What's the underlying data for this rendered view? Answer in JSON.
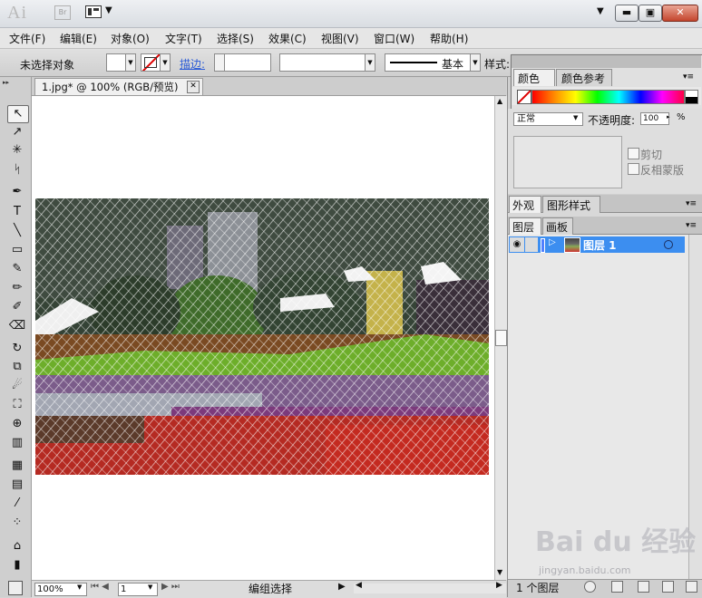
{
  "titlebar": {
    "app_logo": "Ai",
    "bridge_label": "Br",
    "icons": [
      "arrange-documents-icon",
      "chevron-down-icon",
      "minimize-icon",
      "maximize-icon",
      "close-icon"
    ],
    "minimize_glyph": "▬",
    "maximize_glyph": "▣",
    "close_glyph": "✕",
    "dropdown_glyph": "▼"
  },
  "menubar": {
    "items": [
      {
        "label": "文件(F)"
      },
      {
        "label": "编辑(E)"
      },
      {
        "label": "对象(O)"
      },
      {
        "label": "文字(T)"
      },
      {
        "label": "选择(S)"
      },
      {
        "label": "效果(C)"
      },
      {
        "label": "视图(V)"
      },
      {
        "label": "窗口(W)"
      },
      {
        "label": "帮助(H)"
      }
    ]
  },
  "controlbar": {
    "selection_status": "未选择对象",
    "stroke_label": "描边:",
    "stroke_profile": "基本",
    "style_label": "样式:"
  },
  "document": {
    "tab_title": "1.jpg* @ 100% (RGB/预览)",
    "tab_close": "✕"
  },
  "tools": [
    {
      "name": "selection-tool-icon",
      "glyph": "↖"
    },
    {
      "name": "direct-selection-tool-icon",
      "glyph": "↗"
    },
    {
      "name": "magic-wand-tool-icon",
      "glyph": "✳"
    },
    {
      "name": "lasso-tool-icon",
      "glyph": "ᛋ"
    },
    {
      "name": "pen-tool-icon",
      "glyph": "✒"
    },
    {
      "name": "type-tool-icon",
      "glyph": "T"
    },
    {
      "name": "line-segment-tool-icon",
      "glyph": "╲"
    },
    {
      "name": "rectangle-tool-icon",
      "glyph": "▭"
    },
    {
      "name": "paintbrush-tool-icon",
      "glyph": "✎"
    },
    {
      "name": "pencil-tool-icon",
      "glyph": "✏"
    },
    {
      "name": "blob-brush-tool-icon",
      "glyph": "✐"
    },
    {
      "name": "eraser-tool-icon",
      "glyph": "⌫"
    },
    {
      "name": "rotate-tool-icon",
      "glyph": "↻"
    },
    {
      "name": "scale-tool-icon",
      "glyph": "⧉"
    },
    {
      "name": "warp-tool-icon",
      "glyph": "☄"
    },
    {
      "name": "free-transform-tool-icon",
      "glyph": "⛶"
    },
    {
      "name": "shape-builder-tool-icon",
      "glyph": "⊕"
    },
    {
      "name": "graph-tool-icon",
      "glyph": "▥"
    },
    {
      "name": "mesh-tool-icon",
      "glyph": "▦"
    },
    {
      "name": "gradient-tool-icon",
      "glyph": "▤"
    },
    {
      "name": "eyedropper-tool-icon",
      "glyph": "⁄"
    },
    {
      "name": "blend-tool-icon",
      "glyph": "⁘"
    },
    {
      "name": "symbol-sprayer-tool-icon",
      "glyph": "⌂"
    },
    {
      "name": "column-graph-tool-icon",
      "glyph": "▮"
    },
    {
      "name": "artboard-tool-icon",
      "glyph": "⧠"
    }
  ],
  "statusbar": {
    "zoom": "100%",
    "page": "1",
    "status_text": "编组选择",
    "nav_prev": "⏮ ◀",
    "nav_next": "▶ ⏭",
    "play": "▶",
    "scroll_left": "◀",
    "scroll_right": "▶",
    "scroll_up": "▲",
    "scroll_down": "▼"
  },
  "color_panel": {
    "tab_color": "颜色",
    "tab_color_guide": "颜色参考",
    "menu_glyph": "▾≡"
  },
  "transparency_panel": {
    "blend_mode": "正常",
    "opacity_label": "不透明度:",
    "opacity_value": "100",
    "opacity_unit": "%",
    "clip_label": "剪切",
    "invert_mask_label": "反相蒙版"
  },
  "appearance_panel": {
    "tab_appearance": "外观",
    "tab_graphic_styles": "图形样式",
    "menu_glyph": "▾≡"
  },
  "layers_panel": {
    "tab_layers": "图层",
    "tab_artboards": "画板",
    "menu_glyph": "▾≡",
    "layers": [
      {
        "name": "图层 1",
        "visible": true,
        "selected": true,
        "color": "#4f7fff"
      }
    ],
    "footer_count": "1 个图层",
    "eye_glyph": "👁",
    "expand_glyph": "▷"
  },
  "watermark": {
    "brand": "Bai  du 经验",
    "url": "jingyan.baidu.com",
    "paw": "🐾"
  },
  "colors": {
    "selection_blue": "#3c8ef0",
    "panel_gray": "#d0d0d0",
    "close_red": "#c4452d"
  }
}
